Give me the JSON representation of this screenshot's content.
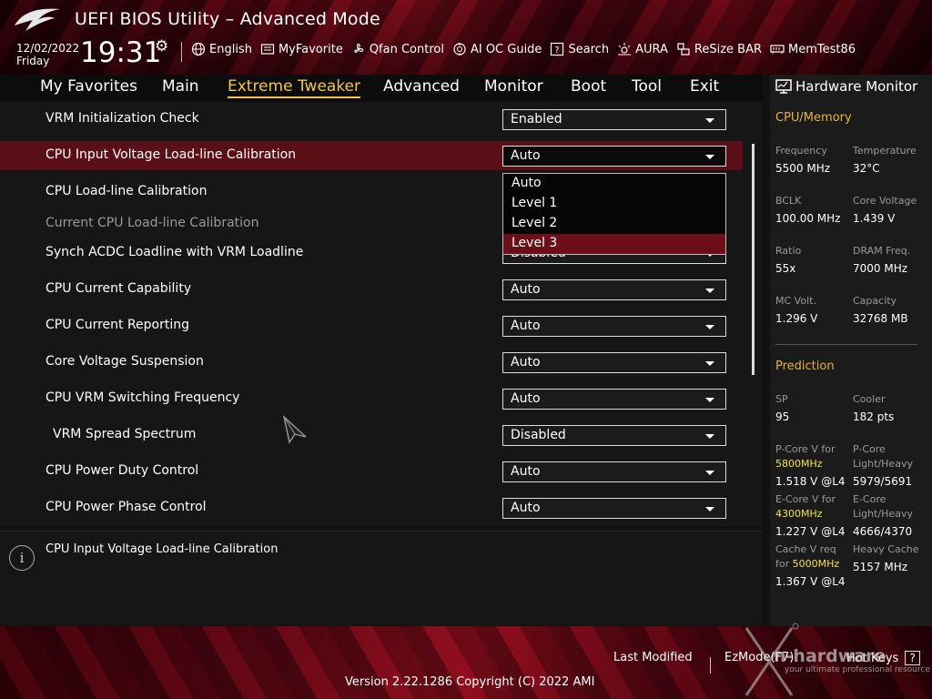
{
  "header": {
    "title": "UEFI BIOS Utility – Advanced Mode",
    "date": "12/02/2022",
    "day": "Friday",
    "time": "19:31",
    "toolbar": [
      {
        "label": "English",
        "icon": "globe-icon"
      },
      {
        "label": "MyFavorite",
        "icon": "favorite-icon"
      },
      {
        "label": "Qfan Control",
        "icon": "fan-icon"
      },
      {
        "label": "AI OC Guide",
        "icon": "oc-guide-icon"
      },
      {
        "label": "Search",
        "icon": "search-icon"
      },
      {
        "label": "AURA",
        "icon": "aura-icon"
      },
      {
        "label": "ReSize BAR",
        "icon": "resize-bar-icon"
      },
      {
        "label": "MemTest86",
        "icon": "memtest-icon"
      }
    ]
  },
  "nav": {
    "tabs": [
      "My Favorites",
      "Main",
      "Extreme Tweaker",
      "Advanced",
      "Monitor",
      "Boot",
      "Tool",
      "Exit"
    ],
    "active": "Extreme Tweaker"
  },
  "settings": [
    {
      "label": "VRM Initialization Check",
      "value": "Enabled"
    },
    {
      "label": "CPU Input Voltage Load-line Calibration",
      "value": "Auto"
    },
    {
      "label": "CPU Load-line Calibration",
      "value": ""
    },
    {
      "label": "Current CPU Load-line Calibration",
      "value": ""
    },
    {
      "label": "Synch ACDC Loadline with VRM Loadline",
      "value": "Disabled"
    },
    {
      "label": "CPU Current Capability",
      "value": "Auto"
    },
    {
      "label": "CPU Current Reporting",
      "value": "Auto"
    },
    {
      "label": "Core Voltage Suspension",
      "value": "Auto"
    },
    {
      "label": "CPU VRM Switching Frequency",
      "value": "Auto"
    },
    {
      "label": "VRM Spread Spectrum",
      "value": "Disabled"
    },
    {
      "label": "CPU Power Duty Control",
      "value": "Auto"
    },
    {
      "label": "CPU Power Phase Control",
      "value": "Auto"
    }
  ],
  "dropdown": {
    "options": [
      "Auto",
      "Level 1",
      "Level 2",
      "Level 3"
    ],
    "selected": "Level 3"
  },
  "help": {
    "text": "CPU Input Voltage Load-line Calibration"
  },
  "hw_monitor": {
    "title": "Hardware Monitor",
    "cpu_memory": {
      "heading": "CPU/Memory",
      "frequency_label": "Frequency",
      "frequency": "5500 MHz",
      "temperature_label": "Temperature",
      "temperature": "32°C",
      "bclk_label": "BCLK",
      "bclk": "100.00 MHz",
      "core_voltage_label": "Core Voltage",
      "core_voltage": "1.439 V",
      "ratio_label": "Ratio",
      "ratio": "55x",
      "dram_freq_label": "DRAM Freq.",
      "dram_freq": "7000 MHz",
      "mc_volt_label": "MC Volt.",
      "mc_volt": "1.296 V",
      "capacity_label": "Capacity",
      "capacity": "32768 MB"
    },
    "prediction": {
      "heading": "Prediction",
      "sp_label": "SP",
      "sp": "95",
      "cooler_label": "Cooler",
      "cooler": "182 pts",
      "pcore_v_label": "P-Core V for",
      "pcore_v_freq": "5800MHz",
      "pcore_v": "1.518 V @L4",
      "pcore_lh_label_1": "P-Core",
      "pcore_lh_label_2": "Light/Heavy",
      "pcore_lh": "5979/5691",
      "ecore_v_label": "E-Core V for",
      "ecore_v_freq": "4300MHz",
      "ecore_v": "1.227 V @L4",
      "ecore_lh_label_1": "E-Core",
      "ecore_lh_label_2": "Light/Heavy",
      "ecore_lh": "4666/4370",
      "cache_v_label_1": "Cache V req",
      "cache_v_label_2": "for",
      "cache_v_freq": "5000MHz",
      "cache_v": "1.367 V @L4",
      "heavy_cache_label": "Heavy Cache",
      "heavy_cache": "5157 MHz"
    }
  },
  "footer": {
    "last_modified": "Last Modified",
    "ezmode": "EzMode(F7)",
    "hot_keys": "Hot Keys",
    "hot_keys_key": "?",
    "version": "Version 2.22.1286 Copyright (C) 2022 AMI"
  },
  "watermark": {
    "text": "n-hardware",
    "tagline": "your ultimate professional resource"
  },
  "colors": {
    "accent": "#f4c54a",
    "highlight": "#5a0f16",
    "selected_option": "#6c0f18",
    "section": "#e4b440"
  }
}
